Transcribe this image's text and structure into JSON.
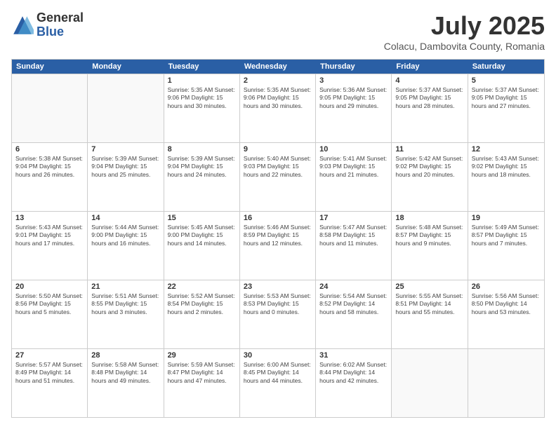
{
  "logo": {
    "general": "General",
    "blue": "Blue"
  },
  "title": "July 2025",
  "location": "Colacu, Dambovita County, Romania",
  "weekdays": [
    "Sunday",
    "Monday",
    "Tuesday",
    "Wednesday",
    "Thursday",
    "Friday",
    "Saturday"
  ],
  "weeks": [
    [
      {
        "day": "",
        "info": ""
      },
      {
        "day": "",
        "info": ""
      },
      {
        "day": "1",
        "info": "Sunrise: 5:35 AM\nSunset: 9:06 PM\nDaylight: 15 hours\nand 30 minutes."
      },
      {
        "day": "2",
        "info": "Sunrise: 5:35 AM\nSunset: 9:06 PM\nDaylight: 15 hours\nand 30 minutes."
      },
      {
        "day": "3",
        "info": "Sunrise: 5:36 AM\nSunset: 9:05 PM\nDaylight: 15 hours\nand 29 minutes."
      },
      {
        "day": "4",
        "info": "Sunrise: 5:37 AM\nSunset: 9:05 PM\nDaylight: 15 hours\nand 28 minutes."
      },
      {
        "day": "5",
        "info": "Sunrise: 5:37 AM\nSunset: 9:05 PM\nDaylight: 15 hours\nand 27 minutes."
      }
    ],
    [
      {
        "day": "6",
        "info": "Sunrise: 5:38 AM\nSunset: 9:04 PM\nDaylight: 15 hours\nand 26 minutes."
      },
      {
        "day": "7",
        "info": "Sunrise: 5:39 AM\nSunset: 9:04 PM\nDaylight: 15 hours\nand 25 minutes."
      },
      {
        "day": "8",
        "info": "Sunrise: 5:39 AM\nSunset: 9:04 PM\nDaylight: 15 hours\nand 24 minutes."
      },
      {
        "day": "9",
        "info": "Sunrise: 5:40 AM\nSunset: 9:03 PM\nDaylight: 15 hours\nand 22 minutes."
      },
      {
        "day": "10",
        "info": "Sunrise: 5:41 AM\nSunset: 9:03 PM\nDaylight: 15 hours\nand 21 minutes."
      },
      {
        "day": "11",
        "info": "Sunrise: 5:42 AM\nSunset: 9:02 PM\nDaylight: 15 hours\nand 20 minutes."
      },
      {
        "day": "12",
        "info": "Sunrise: 5:43 AM\nSunset: 9:02 PM\nDaylight: 15 hours\nand 18 minutes."
      }
    ],
    [
      {
        "day": "13",
        "info": "Sunrise: 5:43 AM\nSunset: 9:01 PM\nDaylight: 15 hours\nand 17 minutes."
      },
      {
        "day": "14",
        "info": "Sunrise: 5:44 AM\nSunset: 9:00 PM\nDaylight: 15 hours\nand 16 minutes."
      },
      {
        "day": "15",
        "info": "Sunrise: 5:45 AM\nSunset: 9:00 PM\nDaylight: 15 hours\nand 14 minutes."
      },
      {
        "day": "16",
        "info": "Sunrise: 5:46 AM\nSunset: 8:59 PM\nDaylight: 15 hours\nand 12 minutes."
      },
      {
        "day": "17",
        "info": "Sunrise: 5:47 AM\nSunset: 8:58 PM\nDaylight: 15 hours\nand 11 minutes."
      },
      {
        "day": "18",
        "info": "Sunrise: 5:48 AM\nSunset: 8:57 PM\nDaylight: 15 hours\nand 9 minutes."
      },
      {
        "day": "19",
        "info": "Sunrise: 5:49 AM\nSunset: 8:57 PM\nDaylight: 15 hours\nand 7 minutes."
      }
    ],
    [
      {
        "day": "20",
        "info": "Sunrise: 5:50 AM\nSunset: 8:56 PM\nDaylight: 15 hours\nand 5 minutes."
      },
      {
        "day": "21",
        "info": "Sunrise: 5:51 AM\nSunset: 8:55 PM\nDaylight: 15 hours\nand 3 minutes."
      },
      {
        "day": "22",
        "info": "Sunrise: 5:52 AM\nSunset: 8:54 PM\nDaylight: 15 hours\nand 2 minutes."
      },
      {
        "day": "23",
        "info": "Sunrise: 5:53 AM\nSunset: 8:53 PM\nDaylight: 15 hours\nand 0 minutes."
      },
      {
        "day": "24",
        "info": "Sunrise: 5:54 AM\nSunset: 8:52 PM\nDaylight: 14 hours\nand 58 minutes."
      },
      {
        "day": "25",
        "info": "Sunrise: 5:55 AM\nSunset: 8:51 PM\nDaylight: 14 hours\nand 55 minutes."
      },
      {
        "day": "26",
        "info": "Sunrise: 5:56 AM\nSunset: 8:50 PM\nDaylight: 14 hours\nand 53 minutes."
      }
    ],
    [
      {
        "day": "27",
        "info": "Sunrise: 5:57 AM\nSunset: 8:49 PM\nDaylight: 14 hours\nand 51 minutes."
      },
      {
        "day": "28",
        "info": "Sunrise: 5:58 AM\nSunset: 8:48 PM\nDaylight: 14 hours\nand 49 minutes."
      },
      {
        "day": "29",
        "info": "Sunrise: 5:59 AM\nSunset: 8:47 PM\nDaylight: 14 hours\nand 47 minutes."
      },
      {
        "day": "30",
        "info": "Sunrise: 6:00 AM\nSunset: 8:45 PM\nDaylight: 14 hours\nand 44 minutes."
      },
      {
        "day": "31",
        "info": "Sunrise: 6:02 AM\nSunset: 8:44 PM\nDaylight: 14 hours\nand 42 minutes."
      },
      {
        "day": "",
        "info": ""
      },
      {
        "day": "",
        "info": ""
      }
    ]
  ]
}
